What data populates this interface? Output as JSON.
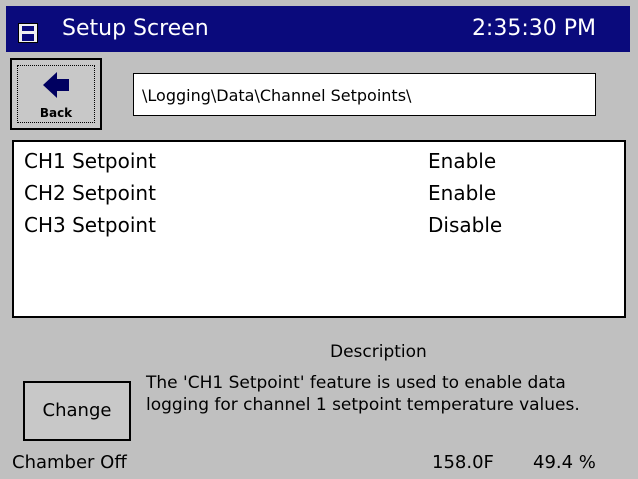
{
  "window": {
    "title": "Setup Screen",
    "time": "2:35:30 PM",
    "icon": "floppy-disk-icon"
  },
  "nav": {
    "back_label": "Back",
    "path": "\\Logging\\Data\\Channel Setpoints\\"
  },
  "list": [
    {
      "name": "CH1 Setpoint",
      "value": "Enable"
    },
    {
      "name": "CH2 Setpoint",
      "value": "Enable"
    },
    {
      "name": "CH3 Setpoint",
      "value": "Disable"
    }
  ],
  "description": {
    "title": "Description",
    "text": "The 'CH1 Setpoint' feature is used to enable data logging for channel 1 setpoint temperature values."
  },
  "actions": {
    "change_label": "Change"
  },
  "status": {
    "chamber": "Chamber Off",
    "temperature": "158.0F",
    "humidity": "49.4 %"
  },
  "colors": {
    "titlebar": "#0a0a7c",
    "background": "#c0c0c0",
    "list_background": "#ffffff"
  }
}
